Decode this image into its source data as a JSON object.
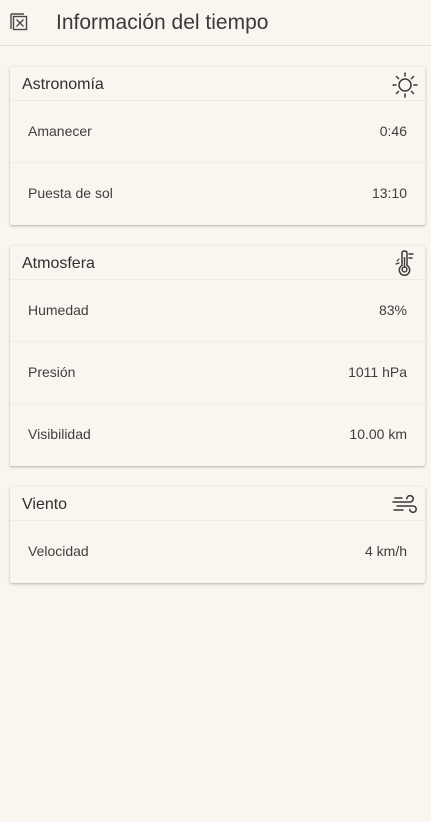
{
  "header": {
    "title": "Información del tiempo",
    "close_icon": "close-box-icon"
  },
  "astronomy": {
    "title": "Astronomía",
    "icon": "sun-icon",
    "rows": [
      {
        "label": "Amanecer",
        "value": "0:46"
      },
      {
        "label": "Puesta de sol",
        "value": "13:10"
      }
    ]
  },
  "atmosphere": {
    "title": "Atmosfera",
    "icon": "thermometer-icon",
    "rows": [
      {
        "label": "Humedad",
        "value": "83%"
      },
      {
        "label": "Presión",
        "value": "1011 hPa"
      },
      {
        "label": "Visibilidad",
        "value": "10.00 km"
      }
    ]
  },
  "wind": {
    "title": "Viento",
    "icon": "wind-icon",
    "rows": [
      {
        "label": "Velocidad",
        "value": "4 km/h"
      }
    ]
  },
  "colors": {
    "background": "#faf5ee",
    "text": "#3a3a3a"
  }
}
